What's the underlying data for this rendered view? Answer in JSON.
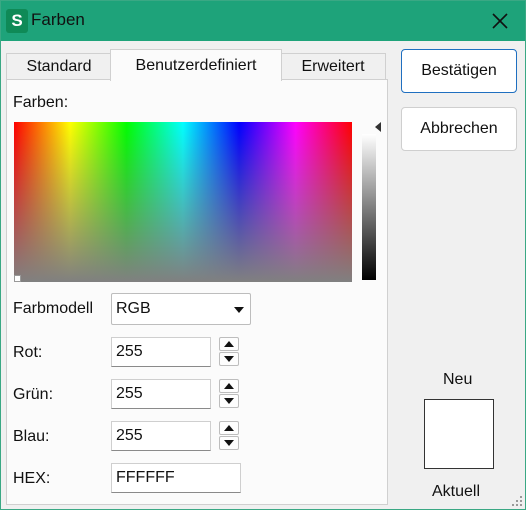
{
  "window": {
    "title": "Farben",
    "app_icon_letter": "S",
    "accent": "#1ea37a"
  },
  "tabs": [
    {
      "label": "Standard",
      "active": false
    },
    {
      "label": "Benutzerdefiniert",
      "active": true
    },
    {
      "label": "Erweitert",
      "active": false
    }
  ],
  "panel": {
    "colors_label": "Farben:",
    "color_model_label": "Farbmodell",
    "color_model_value": "RGB",
    "red_label": "Rot:",
    "red_value": "255",
    "green_label": "Grün:",
    "green_value": "255",
    "blue_label": "Blau:",
    "blue_value": "255",
    "hex_label": "HEX:",
    "hex_value": "FFFFFF"
  },
  "buttons": {
    "confirm": "Bestätigen",
    "cancel": "Abbrechen"
  },
  "preview": {
    "new_label": "Neu",
    "current_label": "Aktuell",
    "color": "#ffffff"
  }
}
